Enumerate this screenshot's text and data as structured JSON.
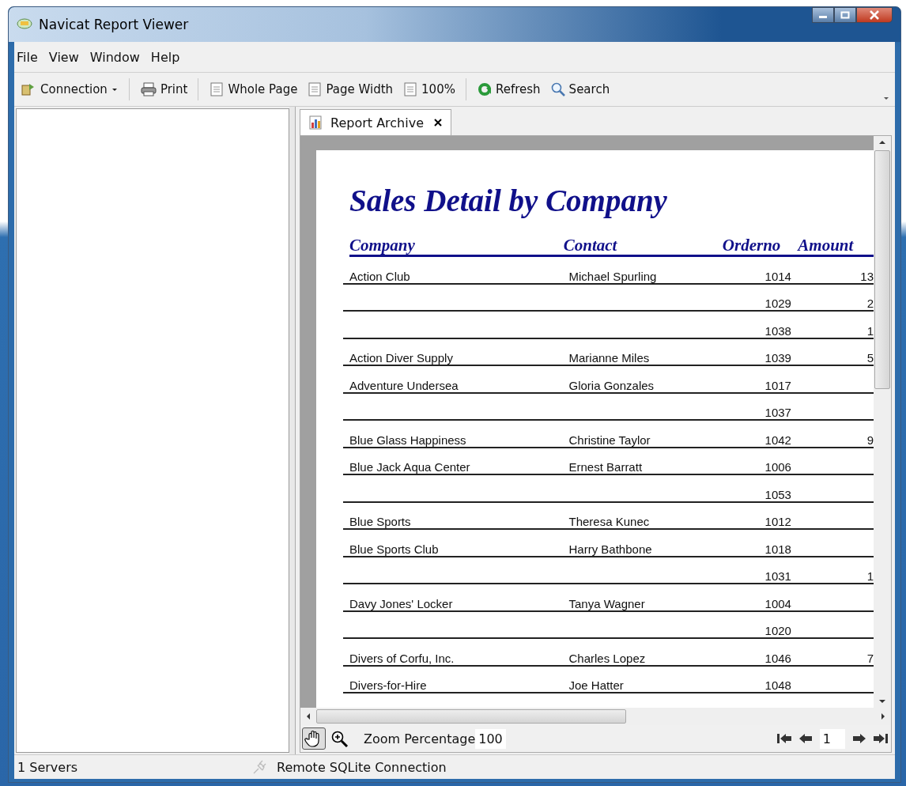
{
  "window": {
    "title": "Navicat Report Viewer"
  },
  "menu": [
    "File",
    "View",
    "Window",
    "Help"
  ],
  "toolbar": [
    {
      "label": "Connection",
      "kind": "connection"
    },
    {
      "label": "Print",
      "kind": "print"
    },
    {
      "label": "Whole Page",
      "kind": "page"
    },
    {
      "label": "Page Width",
      "kind": "page"
    },
    {
      "label": "100%",
      "kind": "page"
    },
    {
      "label": "Refresh",
      "kind": "refresh"
    },
    {
      "label": "Search",
      "kind": "search"
    }
  ],
  "tab": {
    "label": "Report Archive"
  },
  "report": {
    "title": "Sales Detail by Company",
    "columns": [
      "Company",
      "Contact",
      "Orderno",
      "Amount"
    ],
    "rows": [
      {
        "company": "Action Club",
        "contact": "Michael Spurling",
        "orderno": "1014",
        "amount": "13"
      },
      {
        "company": "",
        "contact": "",
        "orderno": "1029",
        "amount": "2"
      },
      {
        "company": "",
        "contact": "",
        "orderno": "1038",
        "amount": "1"
      },
      {
        "company": "Action Diver Supply",
        "contact": "Marianne Miles",
        "orderno": "1039",
        "amount": "5"
      },
      {
        "company": "Adventure Undersea",
        "contact": "Gloria Gonzales",
        "orderno": "1017",
        "amount": ""
      },
      {
        "company": "",
        "contact": "",
        "orderno": "1037",
        "amount": ""
      },
      {
        "company": "Blue Glass Happiness",
        "contact": "Christine Taylor",
        "orderno": "1042",
        "amount": "9"
      },
      {
        "company": "Blue Jack Aqua Center",
        "contact": "Ernest Barratt",
        "orderno": "1006",
        "amount": ""
      },
      {
        "company": "",
        "contact": "",
        "orderno": "1053",
        "amount": ""
      },
      {
        "company": "Blue Sports",
        "contact": "Theresa Kunec",
        "orderno": "1012",
        "amount": ""
      },
      {
        "company": "Blue Sports Club",
        "contact": "Harry Bathbone",
        "orderno": "1018",
        "amount": ""
      },
      {
        "company": "",
        "contact": "",
        "orderno": "1031",
        "amount": "1"
      },
      {
        "company": "Davy Jones' Locker",
        "contact": "Tanya Wagner",
        "orderno": "1004",
        "amount": ""
      },
      {
        "company": "",
        "contact": "",
        "orderno": "1020",
        "amount": ""
      },
      {
        "company": "Divers of Corfu, Inc.",
        "contact": "Charles Lopez",
        "orderno": "1046",
        "amount": "7"
      },
      {
        "company": "Divers-for-Hire",
        "contact": "Joe Hatter",
        "orderno": "1048",
        "amount": ""
      }
    ]
  },
  "viewer_bar": {
    "zoom_label": "Zoom Percentage",
    "zoom_value": "100",
    "page": "1"
  },
  "status_bar": {
    "servers": "1 Servers",
    "connection": "Remote SQLite Connection"
  }
}
